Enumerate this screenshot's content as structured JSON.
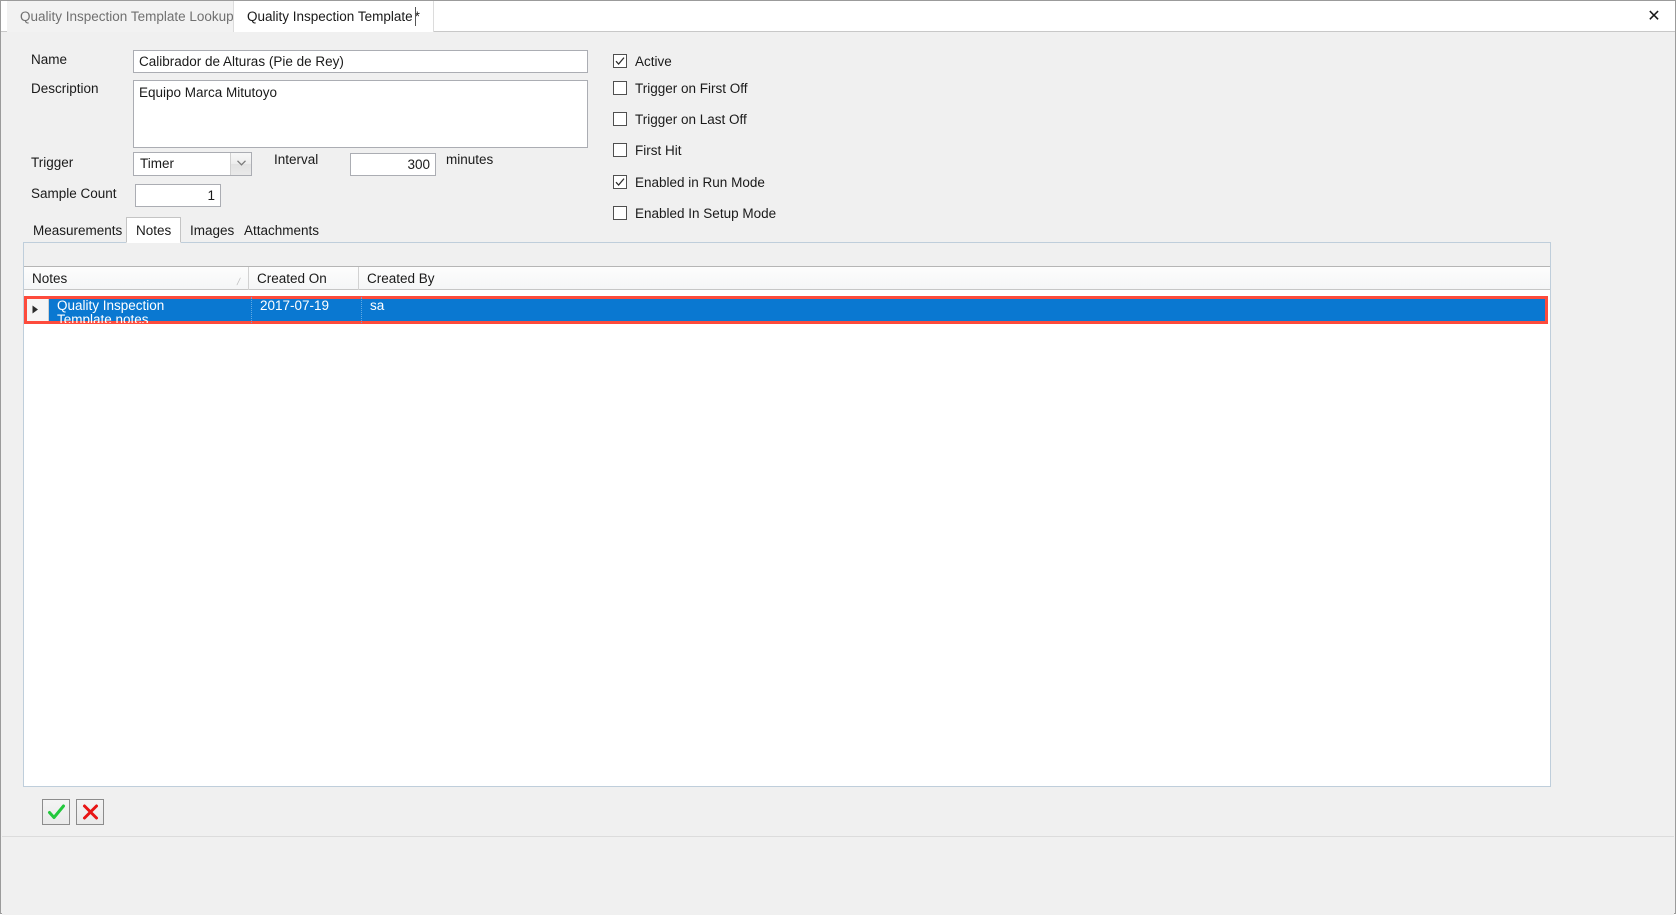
{
  "window": {
    "close_label": "✕"
  },
  "doc_tabs": [
    {
      "label": "Quality Inspection Template Lookup",
      "active": false,
      "dirty": ""
    },
    {
      "label": "Quality Inspection Template",
      "active": true,
      "dirty": "*"
    }
  ],
  "form": {
    "labels": {
      "name": "Name",
      "description": "Description",
      "trigger": "Trigger",
      "interval": "Interval",
      "interval_unit": "minutes",
      "sample_count": "Sample Count"
    },
    "values": {
      "name": "Calibrador de Alturas (Pie de Rey)",
      "description": "Equipo Marca Mitutoyo",
      "trigger": "Timer",
      "interval": "300",
      "sample_count": "1"
    },
    "placeholders": {
      "name": "",
      "description": "",
      "interval": "",
      "sample_count": ""
    },
    "trigger_options": [
      "Timer"
    ]
  },
  "checkboxes": [
    {
      "label": "Active",
      "checked": true
    },
    {
      "label": "Trigger on First Off",
      "checked": false
    },
    {
      "label": "Trigger on Last Off",
      "checked": false
    },
    {
      "label": "First Hit",
      "checked": false
    },
    {
      "label": "Enabled in Run Mode",
      "checked": true
    },
    {
      "label": "Enabled In Setup Mode",
      "checked": false
    }
  ],
  "inner_tabs": [
    {
      "label": "Measurements",
      "selected": false
    },
    {
      "label": "Notes",
      "selected": true
    },
    {
      "label": "Images",
      "selected": false
    },
    {
      "label": "Attachments",
      "selected": false
    }
  ],
  "grid": {
    "columns": [
      {
        "label": "Notes",
        "sorted": "asc"
      },
      {
        "label": "Created On",
        "sorted": ""
      },
      {
        "label": "Created By",
        "sorted": ""
      }
    ],
    "rows": [
      {
        "notes": "Quality Inspection\nTemplate notes",
        "created_on": "2017-07-19",
        "created_by": "sa",
        "selected": true
      }
    ]
  },
  "actions": {
    "ok_label": "OK",
    "cancel_label": "Cancel"
  },
  "colors": {
    "selection_blue": "#0a78d1",
    "highlight_red": "#fd4b3c",
    "ok_green": "#22c83c",
    "cancel_red": "#e81414"
  }
}
